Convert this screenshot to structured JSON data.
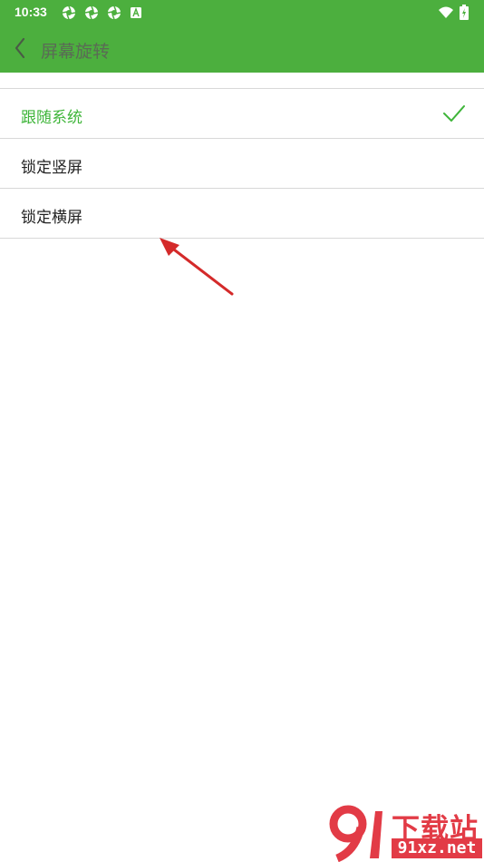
{
  "status_bar": {
    "time": "10:33",
    "icons": [
      "camera-aperture-icon",
      "camera-aperture-icon",
      "camera-aperture-icon",
      "a-badge-icon",
      "wifi-icon",
      "battery-icon"
    ]
  },
  "app_bar": {
    "title": "屏幕旋转",
    "back_icon": "chevron-left-icon"
  },
  "options": [
    {
      "label": "跟随系统",
      "selected": true
    },
    {
      "label": "锁定竖屏",
      "selected": false
    },
    {
      "label": "锁定横屏",
      "selected": false
    }
  ],
  "watermark": {
    "big": "下载站",
    "small": "91xz.net"
  },
  "colors": {
    "app_bar": "#4caf3e",
    "accent": "#3fb53a",
    "annotation_arrow": "#d42a2a",
    "watermark": "#e23b46"
  }
}
